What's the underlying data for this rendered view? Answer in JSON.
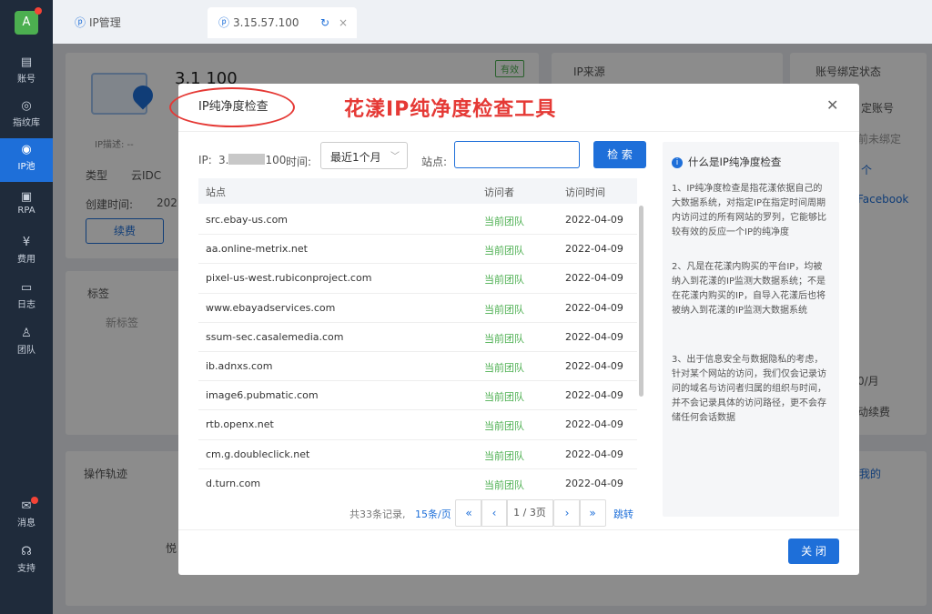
{
  "sidebar": {
    "avatar_letter": "A",
    "items": [
      {
        "label": "账号",
        "icon": "id-card-icon"
      },
      {
        "label": "指纹库",
        "icon": "fingerprint-icon"
      },
      {
        "label": "IP池",
        "icon": "ip-icon"
      },
      {
        "label": "RPA",
        "icon": "robot-icon"
      },
      {
        "label": "费用",
        "icon": "yen-icon"
      },
      {
        "label": "日志",
        "icon": "document-icon"
      },
      {
        "label": "团队",
        "icon": "team-icon"
      },
      {
        "label": "消息",
        "icon": "mail-icon"
      },
      {
        "label": "支持",
        "icon": "headset-icon"
      }
    ]
  },
  "tabs": [
    {
      "label": "IP管理"
    },
    {
      "label": "3.15.57.100"
    }
  ],
  "background": {
    "ip_title": "3.1      100",
    "ip_desc": "IP描述: --",
    "type_label": "类型",
    "type_value": "云IDC",
    "created_label": "创建时间:",
    "created_value": "202",
    "renew_button": "续费",
    "valid_badge": "有效",
    "ip_source": "IP来源",
    "account_bind": "账号绑定状态",
    "tags_title": "标签",
    "new_tag": "新标签",
    "ops_title": "操作轨迹",
    "right_texts": [
      "定账号",
      "前未绑定",
      "个",
      "Facebook",
      "0/月",
      "动续费",
      "我的"
    ],
    "bottom_label": "悦"
  },
  "modal": {
    "title": "IP纯净度检查",
    "annotation": "花漾IP纯净度检查工具",
    "ip_label": "IP:",
    "ip_prefix": "3.",
    "ip_suffix": "100",
    "time_label": "时间:",
    "time_value": "最近1个月",
    "site_label": "站点:",
    "site_placeholder": "",
    "search_button": "检 索",
    "columns": [
      "站点",
      "访问者",
      "访问时间"
    ],
    "rows": [
      {
        "site": "src.ebay-us.com",
        "visitor": "当前团队",
        "time": "2022-04-09"
      },
      {
        "site": "aa.online-metrix.net",
        "visitor": "当前团队",
        "time": "2022-04-09"
      },
      {
        "site": "pixel-us-west.rubiconproject.com",
        "visitor": "当前团队",
        "time": "2022-04-09"
      },
      {
        "site": "www.ebayadservices.com",
        "visitor": "当前团队",
        "time": "2022-04-09"
      },
      {
        "site": "ssum-sec.casalemedia.com",
        "visitor": "当前团队",
        "time": "2022-04-09"
      },
      {
        "site": "ib.adnxs.com",
        "visitor": "当前团队",
        "time": "2022-04-09"
      },
      {
        "site": "image6.pubmatic.com",
        "visitor": "当前团队",
        "time": "2022-04-09"
      },
      {
        "site": "rtb.openx.net",
        "visitor": "当前团队",
        "time": "2022-04-09"
      },
      {
        "site": "cm.g.doubleclick.net",
        "visitor": "当前团队",
        "time": "2022-04-09"
      },
      {
        "site": "d.turn.com",
        "visitor": "当前团队",
        "time": "2022-04-09"
      }
    ],
    "pagination": {
      "total": "共33条记录,",
      "per_page": "15条/页",
      "first": "«",
      "prev": "‹",
      "page_info": "1 / 3页",
      "next": "›",
      "last": "»",
      "goto": "跳转"
    },
    "info": {
      "title": "什么是IP纯净度检查",
      "paragraphs": [
        "1、IP纯净度检查是指花漾依据自己的大数据系统，对指定IP在指定时间周期内访问过的所有网站的罗列，它能够比较有效的反应一个IP的纯净度",
        "2、凡是在花漾内购买的平台IP，均被纳入到花漾的IP监测大数据系统；不是在花漾内购买的IP，自导入花漾后也将被纳入到花漾的IP监测大数据系统",
        "3、出于信息安全与数据隐私的考虑，针对某个网站的访问，我们仅会记录访问的域名与访问者归属的组织与时间，并不会记录具体的访问路径，更不会存储任何会话数据"
      ]
    },
    "close_button": "关 闭"
  }
}
